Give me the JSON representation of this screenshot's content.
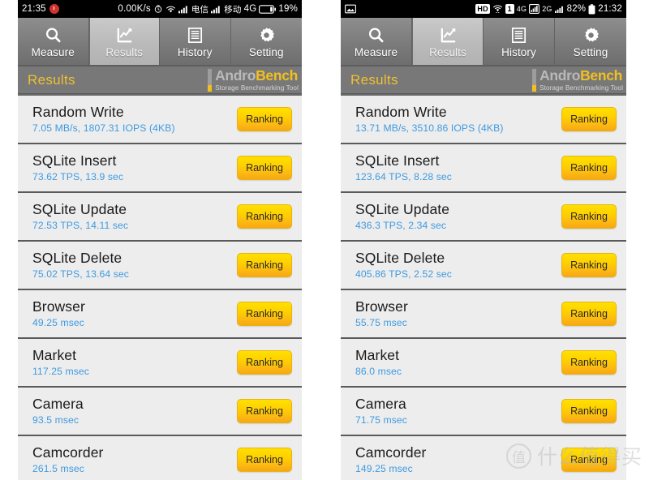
{
  "app": {
    "title": "AndroBench",
    "logo_main_part1": "Andro",
    "logo_main_part2": "Bench",
    "logo_subtitle": "Storage Benchmarking Tool",
    "section_title": "Results"
  },
  "tabs": [
    {
      "label": "Measure",
      "icon": "search-icon",
      "active": false
    },
    {
      "label": "Results",
      "icon": "chart-icon",
      "active": true
    },
    {
      "label": "History",
      "icon": "list-lines-icon",
      "active": false
    },
    {
      "label": "Setting",
      "icon": "gear-icon",
      "active": false
    }
  ],
  "left_phone": {
    "status_bar": {
      "time": "21:35",
      "alarm_icon": "alarm-icon",
      "network_speed": "0.00K/s",
      "stopwatch_icon": "stopwatch-icon",
      "wifi_icon": "wifi-icon",
      "signal1_icon": "signal-bars-icon",
      "carrier1": "电信",
      "signal2_icon": "signal-bars-icon",
      "carrier2": "移动",
      "network_type": "4G",
      "battery_icon": "battery-icon",
      "battery_percent": "19%"
    },
    "rows": [
      {
        "title": "Random Write",
        "value": "7.05 MB/s, 1807.31 IOPS (4KB)",
        "button": "Ranking"
      },
      {
        "title": "SQLite Insert",
        "value": "73.62 TPS, 13.9 sec",
        "button": "Ranking"
      },
      {
        "title": "SQLite Update",
        "value": "72.53 TPS, 14.11 sec",
        "button": "Ranking"
      },
      {
        "title": "SQLite Delete",
        "value": "75.02 TPS, 13.64 sec",
        "button": "Ranking"
      },
      {
        "title": "Browser",
        "value": "49.25 msec",
        "button": "Ranking"
      },
      {
        "title": "Market",
        "value": "117.25 msec",
        "button": "Ranking"
      },
      {
        "title": "Camera",
        "value": "93.5 msec",
        "button": "Ranking"
      },
      {
        "title": "Camcorder",
        "value": "261.5 msec",
        "button": "Ranking"
      }
    ]
  },
  "right_phone": {
    "status_bar": {
      "photo_icon": "photo-icon",
      "hd_badge": "HD",
      "wifi_icon": "wifi-icon",
      "sim_badge": "1",
      "network_type1": "4G",
      "signal1_icon": "signal-bars-icon",
      "network_type2": "2G",
      "signal2_icon": "signal-bars-icon",
      "battery_percent": "82%",
      "battery_icon": "battery-icon",
      "time": "21:32"
    },
    "rows": [
      {
        "title": "Random Write",
        "value": "13.71 MB/s, 3510.86 IOPS (4KB)",
        "button": "Ranking"
      },
      {
        "title": "SQLite Insert",
        "value": "123.64 TPS, 8.28 sec",
        "button": "Ranking"
      },
      {
        "title": "SQLite Update",
        "value": "436.3 TPS, 2.34 sec",
        "button": "Ranking"
      },
      {
        "title": "SQLite Delete",
        "value": "405.86 TPS, 2.52 sec",
        "button": "Ranking"
      },
      {
        "title": "Browser",
        "value": "55.75 msec",
        "button": "Ranking"
      },
      {
        "title": "Market",
        "value": "86.0 msec",
        "button": "Ranking"
      },
      {
        "title": "Camera",
        "value": "71.75 msec",
        "button": "Ranking"
      },
      {
        "title": "Camcorder",
        "value": "149.25 msec",
        "button": "Ranking"
      }
    ]
  },
  "watermark": {
    "mark": "值",
    "text": "什么值得买"
  },
  "colors": {
    "accent_yellow": "#f2c01e",
    "value_blue": "#3f9ae0",
    "row_bg": "#ededed",
    "tabbar_gray": "#7b7b7b",
    "titlebar_gray": "#787878"
  }
}
